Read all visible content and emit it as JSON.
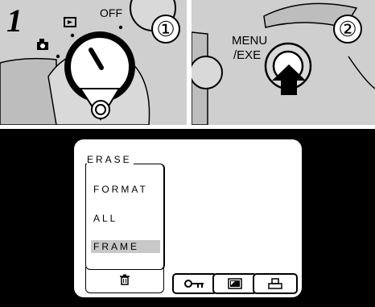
{
  "step": {
    "number": "1"
  },
  "panel_left": {
    "circle_label": "①",
    "dial_off_label": "OFF"
  },
  "panel_right": {
    "circle_label": "②",
    "button_label_line1": "MENU",
    "button_label_line2": "/EXE"
  },
  "lcd_menu": {
    "title": "ERASE",
    "items": [
      "FORMAT",
      "ALL",
      "FRAME"
    ],
    "selected_item": "FRAME",
    "tabs": [
      "erase-trash-icon",
      "protect-key-icon",
      "image-icon",
      "print-icon"
    ]
  },
  "colors": {
    "panel_gray": "#cfcfcf",
    "highlight_gray": "#c8c8c8",
    "screen_bg": "#000000"
  }
}
